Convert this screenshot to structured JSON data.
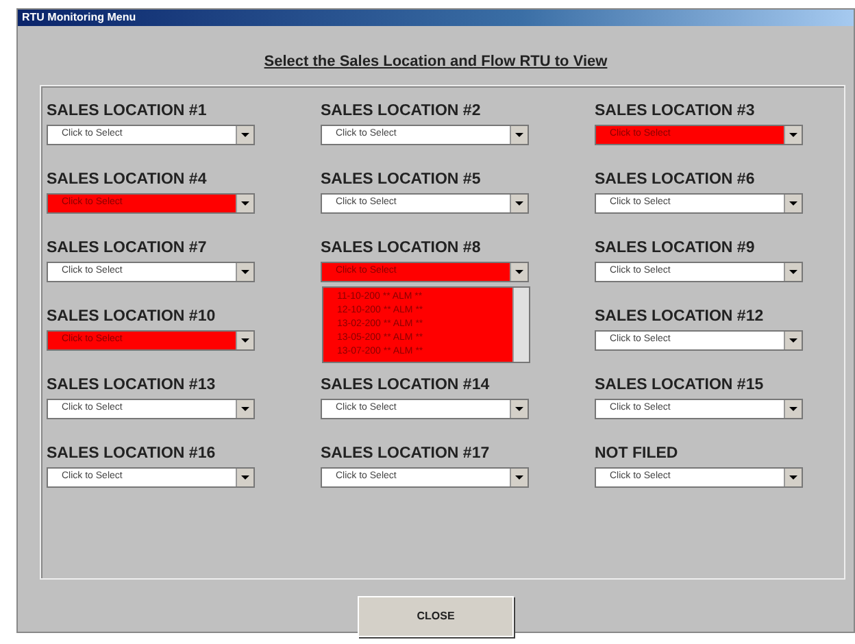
{
  "window": {
    "title": "RTU Monitoring Menu"
  },
  "heading": "Select the Sales Location and Flow RTU to View",
  "locations": [
    {
      "label": "SALES LOCATION #1",
      "value": "Click to Select",
      "alarm": false
    },
    {
      "label": "SALES LOCATION #2",
      "value": "Click to Select",
      "alarm": false
    },
    {
      "label": "SALES LOCATION #3",
      "value": "Click to Select",
      "alarm": true
    },
    {
      "label": "SALES LOCATION #4",
      "value": "Click to Select",
      "alarm": true
    },
    {
      "label": "SALES LOCATION #5",
      "value": "Click to Select",
      "alarm": false
    },
    {
      "label": "SALES LOCATION #6",
      "value": "Click to Select",
      "alarm": false
    },
    {
      "label": "SALES LOCATION #7",
      "value": "Click to Select",
      "alarm": false
    },
    {
      "label": "SALES LOCATION #8",
      "value": "Click to Select",
      "alarm": true,
      "options": [
        "11-10-200 ** ALM **",
        "12-10-200 ** ALM **",
        "13-02-200 ** ALM **",
        "13-05-200 ** ALM **",
        "13-07-200 ** ALM **"
      ]
    },
    {
      "label": "SALES LOCATION #9",
      "value": "Click to Select",
      "alarm": false
    },
    {
      "label": "SALES LOCATION #10",
      "value": "Click to Select",
      "alarm": true
    },
    {
      "kind": "hidden"
    },
    {
      "label": "SALES LOCATION #12",
      "value": "Click to Select",
      "alarm": false
    },
    {
      "label": "SALES LOCATION #13",
      "value": "Click to Select",
      "alarm": false
    },
    {
      "label": "SALES LOCATION #14",
      "value": "Click to Select",
      "alarm": false
    },
    {
      "label": "SALES LOCATION #15",
      "value": "Click to Select",
      "alarm": false
    },
    {
      "label": "SALES LOCATION #16",
      "value": "Click to Select",
      "alarm": false
    },
    {
      "label": "SALES LOCATION #17",
      "value": "Click to Select",
      "alarm": false
    },
    {
      "label": "NOT FILED",
      "value": "Click to Select",
      "alarm": false
    }
  ],
  "close_button": "CLOSE"
}
